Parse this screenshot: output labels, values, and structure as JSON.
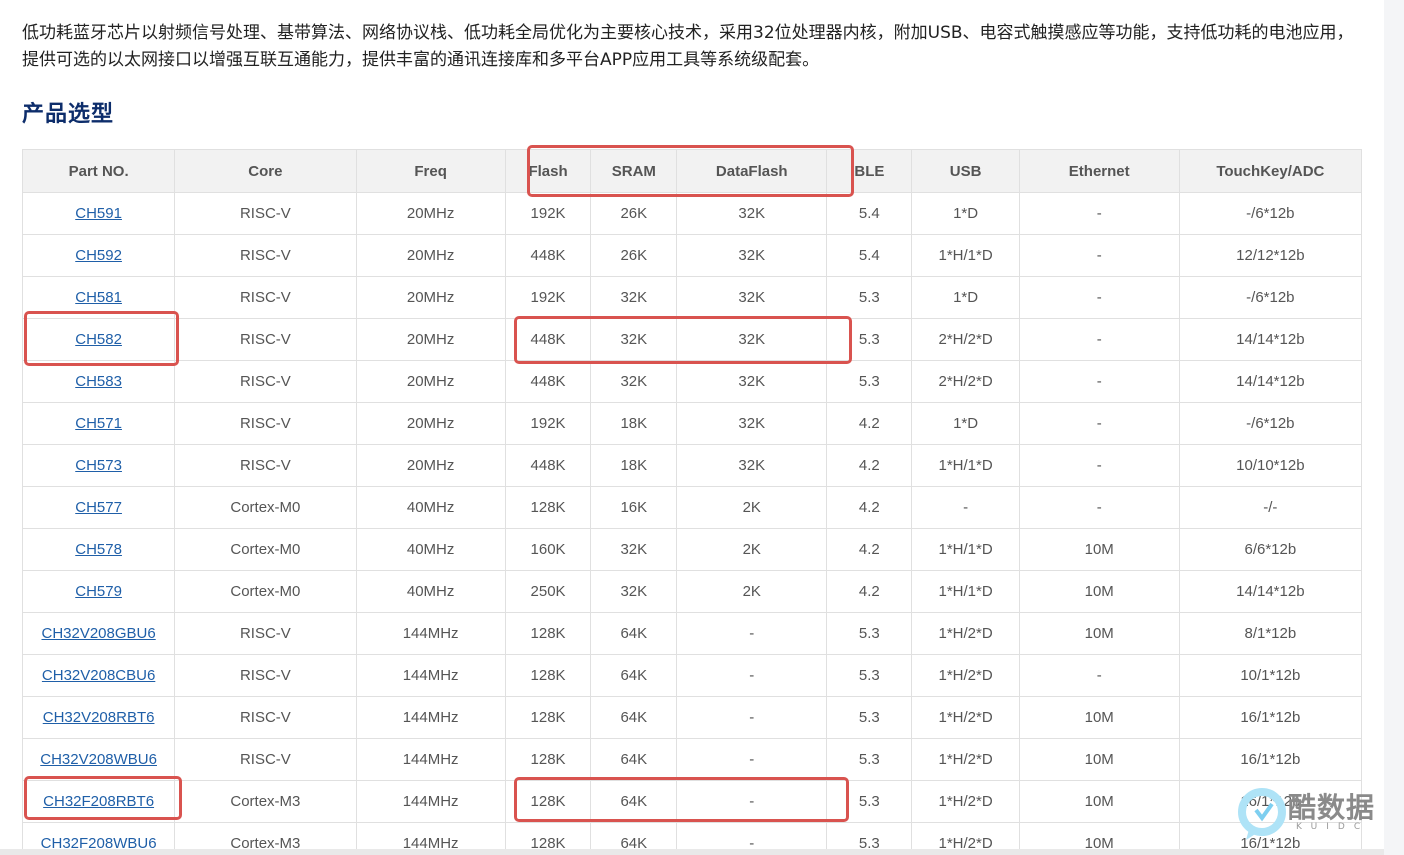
{
  "intro_text": "低功耗蓝牙芯片以射频信号处理、基带算法、网络协议栈、低功耗全局优化为主要核心技术，采用32位处理器内核，附加USB、电容式触摸感应等功能，支持低功耗的电池应用，提供可选的以太网接口以增强互联互通能力，提供丰富的通讯连接库和多平台APP应用工具等系统级配套。",
  "section_title": "产品选型",
  "table": {
    "columns": [
      "Part NO.",
      "Core",
      "Freq",
      "Flash",
      "SRAM",
      "DataFlash",
      "BLE",
      "USB",
      "Ethernet",
      "TouchKey/ADC"
    ],
    "rows": [
      [
        "CH591",
        "RISC-V",
        "20MHz",
        "192K",
        "26K",
        "32K",
        "5.4",
        "1*D",
        "-",
        "-/6*12b"
      ],
      [
        "CH592",
        "RISC-V",
        "20MHz",
        "448K",
        "26K",
        "32K",
        "5.4",
        "1*H/1*D",
        "-",
        "12/12*12b"
      ],
      [
        "CH581",
        "RISC-V",
        "20MHz",
        "192K",
        "32K",
        "32K",
        "5.3",
        "1*D",
        "-",
        "-/6*12b"
      ],
      [
        "CH582",
        "RISC-V",
        "20MHz",
        "448K",
        "32K",
        "32K",
        "5.3",
        "2*H/2*D",
        "-",
        "14/14*12b"
      ],
      [
        "CH583",
        "RISC-V",
        "20MHz",
        "448K",
        "32K",
        "32K",
        "5.3",
        "2*H/2*D",
        "-",
        "14/14*12b"
      ],
      [
        "CH571",
        "RISC-V",
        "20MHz",
        "192K",
        "18K",
        "32K",
        "4.2",
        "1*D",
        "-",
        "-/6*12b"
      ],
      [
        "CH573",
        "RISC-V",
        "20MHz",
        "448K",
        "18K",
        "32K",
        "4.2",
        "1*H/1*D",
        "-",
        "10/10*12b"
      ],
      [
        "CH577",
        "Cortex-M0",
        "40MHz",
        "128K",
        "16K",
        "2K",
        "4.2",
        "-",
        "-",
        "-/-"
      ],
      [
        "CH578",
        "Cortex-M0",
        "40MHz",
        "160K",
        "32K",
        "2K",
        "4.2",
        "1*H/1*D",
        "10M",
        "6/6*12b"
      ],
      [
        "CH579",
        "Cortex-M0",
        "40MHz",
        "250K",
        "32K",
        "2K",
        "4.2",
        "1*H/1*D",
        "10M",
        "14/14*12b"
      ],
      [
        "CH32V208GBU6",
        "RISC-V",
        "144MHz",
        "128K",
        "64K",
        "-",
        "5.3",
        "1*H/2*D",
        "10M",
        "8/1*12b"
      ],
      [
        "CH32V208CBU6",
        "RISC-V",
        "144MHz",
        "128K",
        "64K",
        "-",
        "5.3",
        "1*H/2*D",
        "-",
        "10/1*12b"
      ],
      [
        "CH32V208RBT6",
        "RISC-V",
        "144MHz",
        "128K",
        "64K",
        "-",
        "5.3",
        "1*H/2*D",
        "10M",
        "16/1*12b"
      ],
      [
        "CH32V208WBU6",
        "RISC-V",
        "144MHz",
        "128K",
        "64K",
        "-",
        "5.3",
        "1*H/2*D",
        "10M",
        "16/1*12b"
      ],
      [
        "CH32F208RBT6",
        "Cortex-M3",
        "144MHz",
        "128K",
        "64K",
        "-",
        "5.3",
        "1*H/2*D",
        "10M",
        "16/1*12b"
      ],
      [
        "CH32F208WBU6",
        "Cortex-M3",
        "144MHz",
        "128K",
        "64K",
        "-",
        "5.3",
        "1*H/2*D",
        "10M",
        "16/1*12b"
      ]
    ]
  },
  "watermark": {
    "brand": "酷数据",
    "sub": "KUIDC"
  },
  "colors": {
    "highlight": "#d9534f",
    "link": "#1f5fa8",
    "title": "#0d2d6b",
    "header_bg": "#f2f2f2"
  }
}
